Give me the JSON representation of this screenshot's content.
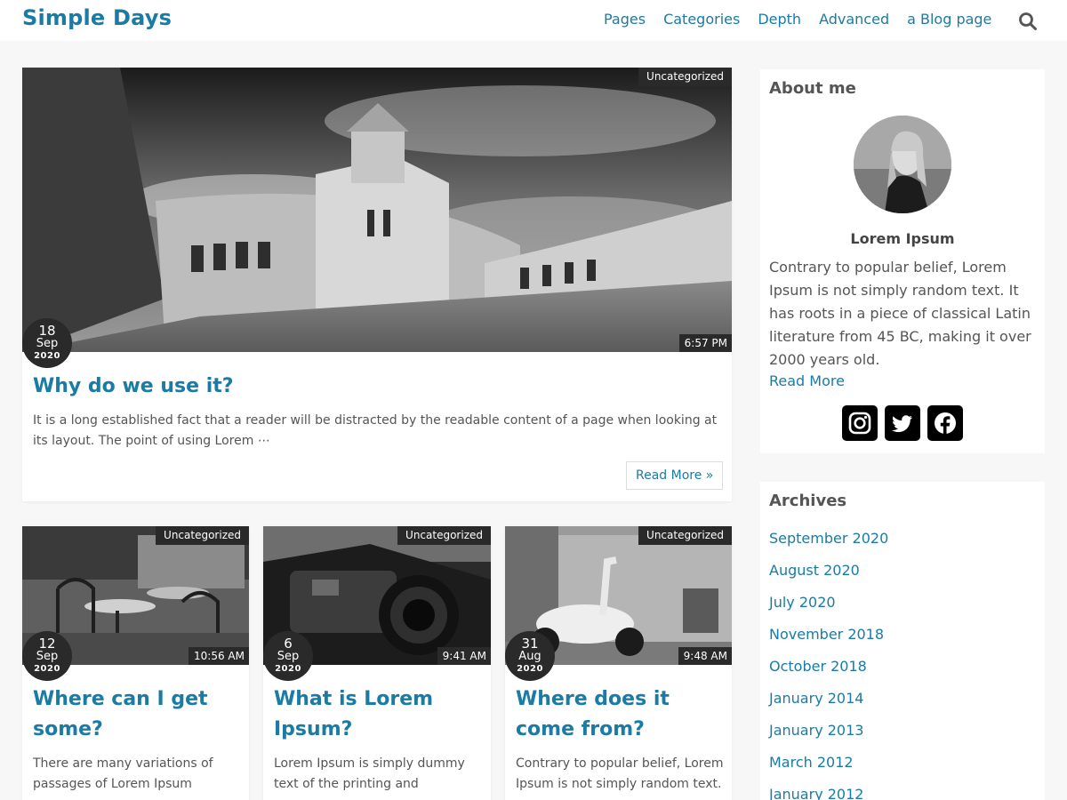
{
  "site": {
    "title": "Simple Days"
  },
  "nav": {
    "items": [
      "Pages",
      "Categories",
      "Depth",
      "Advanced",
      "a Blog page"
    ]
  },
  "icons": {
    "search": "search-icon",
    "instagram": "instagram-icon",
    "twitter": "twitter-icon",
    "facebook": "facebook-icon"
  },
  "colors": {
    "accent": "#1a7ba5",
    "badge": "#2a2a2a",
    "background": "#f7f7f7"
  },
  "featured_post": {
    "category": "Uncategorized",
    "time": "6:57 PM",
    "date": {
      "day": "18",
      "month": "Sep",
      "year": "2020"
    },
    "title": "Why do we use it?",
    "excerpt": "It is a long established fact that a reader will be distracted by the readable content of a page when looking at its layout. The point of using Lorem ⋯",
    "read_more": "Read More »"
  },
  "posts": [
    {
      "category": "Uncategorized",
      "time": "10:56 AM",
      "date": {
        "day": "12",
        "month": "Sep",
        "year": "2020"
      },
      "title": "Where can I get some?",
      "excerpt": "There are many variations of passages of Lorem Ipsum"
    },
    {
      "category": "Uncategorized",
      "time": "9:41 AM",
      "date": {
        "day": "6",
        "month": "Sep",
        "year": "2020"
      },
      "title": "What is Lorem Ipsum?",
      "excerpt": "Lorem Ipsum is simply dummy text of the printing and"
    },
    {
      "category": "Uncategorized",
      "time": "9:48 AM",
      "date": {
        "day": "31",
        "month": "Aug",
        "year": "2020"
      },
      "title": "Where does it come from?",
      "excerpt": "Contrary to popular belief, Lorem Ipsum is not simply random text."
    }
  ],
  "about": {
    "title": "About me",
    "name": "Lorem Ipsum",
    "text": "Contrary to popular belief, Lorem Ipsum is not simply random text. It has roots in a piece of classical Latin literature from 45 BC, making it over 2000 years old.",
    "link": "Read More"
  },
  "archives": {
    "title": "Archives",
    "items": [
      "September 2020",
      "August 2020",
      "July 2020",
      "November 2018",
      "October 2018",
      "January 2014",
      "January 2013",
      "March 2012",
      "January 2012"
    ]
  }
}
